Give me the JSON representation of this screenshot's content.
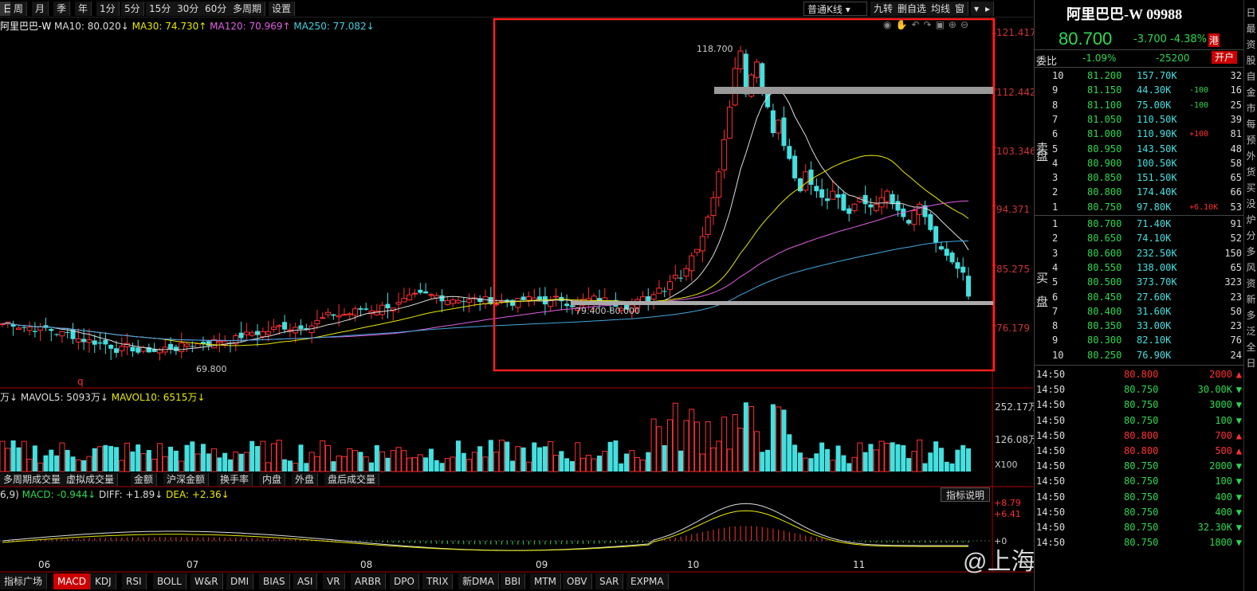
{
  "toolbar": {
    "tabs": [
      "日",
      "周",
      "月",
      "季",
      "年",
      "1分",
      "5分",
      "15分",
      "30分",
      "60分",
      "多周期",
      "设置"
    ],
    "kline_type": "普通K线",
    "right_buttons": [
      "九转",
      "删自选",
      "均线",
      "窗"
    ]
  },
  "indicators": {
    "stock": "阿里巴巴-W",
    "ma10": "MA10: 80.020↓",
    "ma30": "MA30: 74.730↑",
    "ma120": "MA120: 70.969↑",
    "ma250": "MA250: 77.082↓"
  },
  "price_axis": [
    "121.417",
    "112.442",
    "103.346",
    "94.371",
    "85.275",
    "76.179"
  ],
  "annotations": {
    "high": "118.700",
    "low": "69.800",
    "support": "79.400-80.000",
    "marker": "q"
  },
  "volume": {
    "header_left": "万↓",
    "mavol5": "MAVOL5: 5093万↓",
    "mavol10": "MAVOL10: 6515万↓",
    "axis_top": "252.17万",
    "axis_mid": "126.08万",
    "unit": "X100"
  },
  "volume_tabs": [
    "多周期成交量",
    "虚拟成交量",
    "金额",
    "沪深金额",
    "换手率",
    "内盘",
    "外盘",
    "盘后成交量"
  ],
  "macd": {
    "params": "6,9)",
    "macd": "MACD: -0.944↓",
    "diff": "DIFF: +1.89↓",
    "dea": "DEA: +2.36↓",
    "help": "指标说明",
    "axis": [
      "+8.79",
      "+6.41",
      "+0"
    ]
  },
  "x_axis": [
    "06",
    "07",
    "08",
    "09",
    "10",
    "11"
  ],
  "bottom_tabs": [
    "指标广场",
    "MACD",
    "KDJ",
    "RSI",
    "BOLL",
    "W&R",
    "DMI",
    "BIAS",
    "ASI",
    "VR",
    "ARBR",
    "DPO",
    "TRIX",
    "新DMA",
    "BBI",
    "MTM",
    "OBV",
    "SAR",
    "EXPMA"
  ],
  "watermark": "@上海阿森Asen",
  "quote": {
    "name": "阿里巴巴-W 09988",
    "price": "80.700",
    "change": "-3.700",
    "pct": "-4.38%",
    "flag": "港",
    "weibi_label": "委比",
    "weibi": "-1.09%",
    "weicha": "-25200",
    "open_btn": "开户",
    "sell_label": [
      "卖",
      "盘"
    ],
    "buy_label": [
      "买",
      "盘"
    ]
  },
  "asks": [
    {
      "lv": "10",
      "p": "81.200",
      "v": "157.70K",
      "d": "",
      "n": "32"
    },
    {
      "lv": "9",
      "p": "81.150",
      "v": "44.30K",
      "d": "-100",
      "n": "16"
    },
    {
      "lv": "8",
      "p": "81.100",
      "v": "75.00K",
      "d": "-100",
      "n": "25"
    },
    {
      "lv": "7",
      "p": "81.050",
      "v": "110.50K",
      "d": "",
      "n": "39"
    },
    {
      "lv": "6",
      "p": "81.000",
      "v": "110.90K",
      "d": "+100",
      "n": "81"
    },
    {
      "lv": "5",
      "p": "80.950",
      "v": "143.50K",
      "d": "",
      "n": "48"
    },
    {
      "lv": "4",
      "p": "80.900",
      "v": "100.50K",
      "d": "",
      "n": "58"
    },
    {
      "lv": "3",
      "p": "80.850",
      "v": "151.50K",
      "d": "",
      "n": "65"
    },
    {
      "lv": "2",
      "p": "80.800",
      "v": "174.40K",
      "d": "",
      "n": "66"
    },
    {
      "lv": "1",
      "p": "80.750",
      "v": "97.80K",
      "d": "+6.10K",
      "n": "53"
    }
  ],
  "bids": [
    {
      "lv": "1",
      "p": "80.700",
      "v": "71.40K",
      "n": "91"
    },
    {
      "lv": "2",
      "p": "80.650",
      "v": "74.10K",
      "n": "52"
    },
    {
      "lv": "3",
      "p": "80.600",
      "v": "232.50K",
      "n": "150"
    },
    {
      "lv": "4",
      "p": "80.550",
      "v": "138.00K",
      "n": "65"
    },
    {
      "lv": "5",
      "p": "80.500",
      "v": "373.70K",
      "n": "323"
    },
    {
      "lv": "6",
      "p": "80.450",
      "v": "27.60K",
      "n": "23"
    },
    {
      "lv": "7",
      "p": "80.400",
      "v": "31.60K",
      "n": "50"
    },
    {
      "lv": "8",
      "p": "80.350",
      "v": "33.00K",
      "n": "23"
    },
    {
      "lv": "9",
      "p": "80.300",
      "v": "82.10K",
      "n": "76"
    },
    {
      "lv": "10",
      "p": "80.250",
      "v": "76.90K",
      "n": "24"
    }
  ],
  "trades": [
    {
      "t": "14:50",
      "p": "80.800",
      "v": "2000",
      "dir": "up"
    },
    {
      "t": "14:50",
      "p": "80.750",
      "v": "30.00K",
      "dir": "down"
    },
    {
      "t": "14:50",
      "p": "80.750",
      "v": "3000",
      "dir": "down"
    },
    {
      "t": "14:50",
      "p": "80.750",
      "v": "100",
      "dir": "down"
    },
    {
      "t": "14:50",
      "p": "80.800",
      "v": "700",
      "dir": "up"
    },
    {
      "t": "14:50",
      "p": "80.800",
      "v": "500",
      "dir": "up"
    },
    {
      "t": "14:50",
      "p": "80.750",
      "v": "2000",
      "dir": "down"
    },
    {
      "t": "14:50",
      "p": "80.750",
      "v": "100",
      "dir": "down"
    },
    {
      "t": "14:50",
      "p": "80.750",
      "v": "400",
      "dir": "down"
    },
    {
      "t": "14:50",
      "p": "80.750",
      "v": "400",
      "dir": "down"
    },
    {
      "t": "14:50",
      "p": "80.750",
      "v": "32.30K",
      "dir": "down"
    },
    {
      "t": "14:50",
      "p": "80.750",
      "v": "1800",
      "dir": "down"
    }
  ],
  "side_strip": [
    "日",
    "最",
    "资",
    "股",
    "自",
    "金",
    "市",
    "每",
    "预",
    "外",
    "货",
    "买",
    "没",
    "炉",
    "分",
    "多",
    "风",
    "资",
    "新",
    "多",
    "泛",
    "全",
    "日"
  ],
  "colors": {
    "up": "#ff3030",
    "down": "#2fd84f",
    "cyan": "#44e0e0",
    "box": "#ff2020"
  }
}
